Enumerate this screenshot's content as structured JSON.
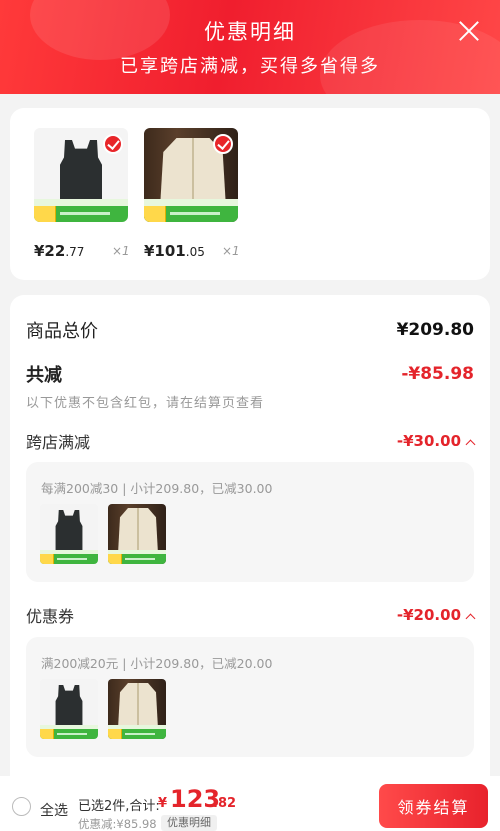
{
  "header": {
    "title": "优惠明细",
    "subtitle": "已享跨店满减，买得多省得多",
    "close_icon": "close-icon"
  },
  "items": [
    {
      "name": "tank-top",
      "price_int": "¥22",
      "price_dec": ".77",
      "qty": "×1",
      "checked": true
    },
    {
      "name": "jacket",
      "price_int": "¥101",
      "price_dec": ".05",
      "qty": "×1",
      "checked": true
    }
  ],
  "summary": {
    "total_label": "商品总价",
    "total_value": "¥209.80",
    "reduce_label": "共减",
    "reduce_value": "-¥85.98",
    "note": "以下优惠不包含红包，请在结算页查看",
    "sections": [
      {
        "label": "跨店满减",
        "value": "-¥30.00",
        "desc": "每满200减30 | 小计209.80，已减30.00"
      },
      {
        "label": "优惠券",
        "value": "-¥20.00",
        "desc": "满200减20元 | 小计209.80，已减20.00"
      }
    ]
  },
  "bottom": {
    "select_all": "全选",
    "selected_text": "已选2件,合计:",
    "sum_symbol": "¥",
    "sum_int": "123",
    "sum_dec": ".82",
    "saved": "优惠减:¥85.98",
    "detail_label": "优惠明细",
    "checkout_label": "领券结算"
  },
  "colors": {
    "accent": "#e4242b",
    "header": "#f01e2e"
  }
}
